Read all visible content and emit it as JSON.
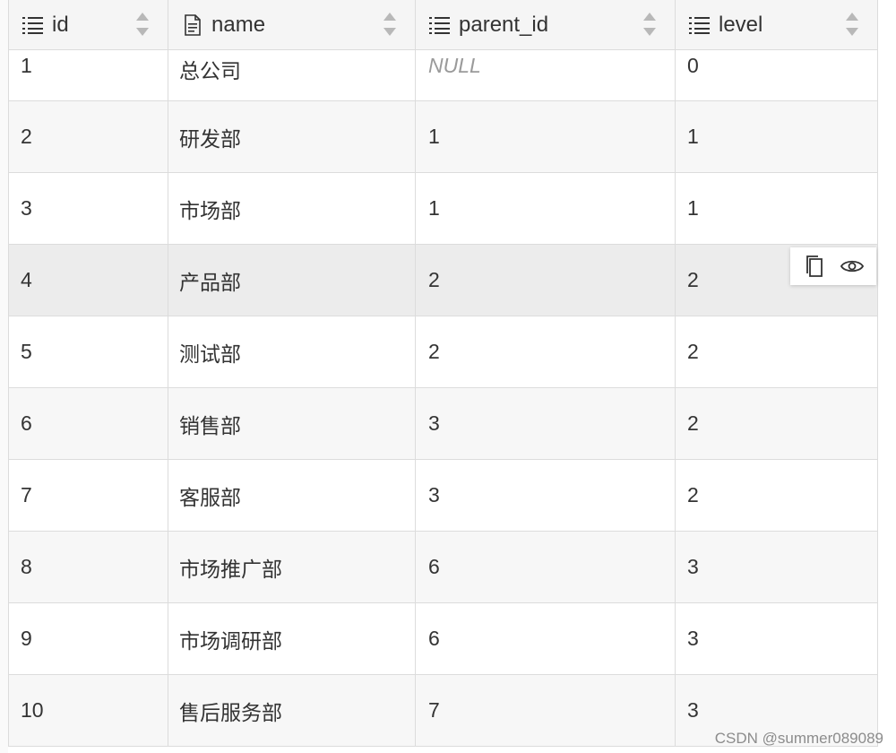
{
  "table": {
    "columns": [
      {
        "key": "id",
        "label": "id",
        "icon": "list-icon"
      },
      {
        "key": "name",
        "label": "name",
        "icon": "document-icon"
      },
      {
        "key": "parent_id",
        "label": "parent_id",
        "icon": "list-icon"
      },
      {
        "key": "level",
        "label": "level",
        "icon": "list-icon"
      }
    ],
    "rows": [
      {
        "id": "1",
        "name": "总公司",
        "parent_id": "NULL",
        "level": "0"
      },
      {
        "id": "2",
        "name": "研发部",
        "parent_id": "1",
        "level": "1"
      },
      {
        "id": "3",
        "name": "市场部",
        "parent_id": "1",
        "level": "1"
      },
      {
        "id": "4",
        "name": "产品部",
        "parent_id": "2",
        "level": "2"
      },
      {
        "id": "5",
        "name": "测试部",
        "parent_id": "2",
        "level": "2"
      },
      {
        "id": "6",
        "name": "销售部",
        "parent_id": "3",
        "level": "2"
      },
      {
        "id": "7",
        "name": "客服部",
        "parent_id": "3",
        "level": "2"
      },
      {
        "id": "8",
        "name": "市场推广部",
        "parent_id": "6",
        "level": "3"
      },
      {
        "id": "9",
        "name": "市场调研部",
        "parent_id": "6",
        "level": "3"
      },
      {
        "id": "10",
        "name": "售后服务部",
        "parent_id": "7",
        "level": "3"
      }
    ]
  },
  "row_actions": {
    "copy_icon": "copy-icon",
    "view_icon": "eye-icon"
  },
  "watermark": "CSDN @summer089089",
  "colors": {
    "header_bg": "#f5f5f5",
    "alt_row_bg": "#f7f7f7",
    "hover_row_bg": "#ececec",
    "border": "#dcdcdc",
    "null_text": "#9a9a9a"
  }
}
